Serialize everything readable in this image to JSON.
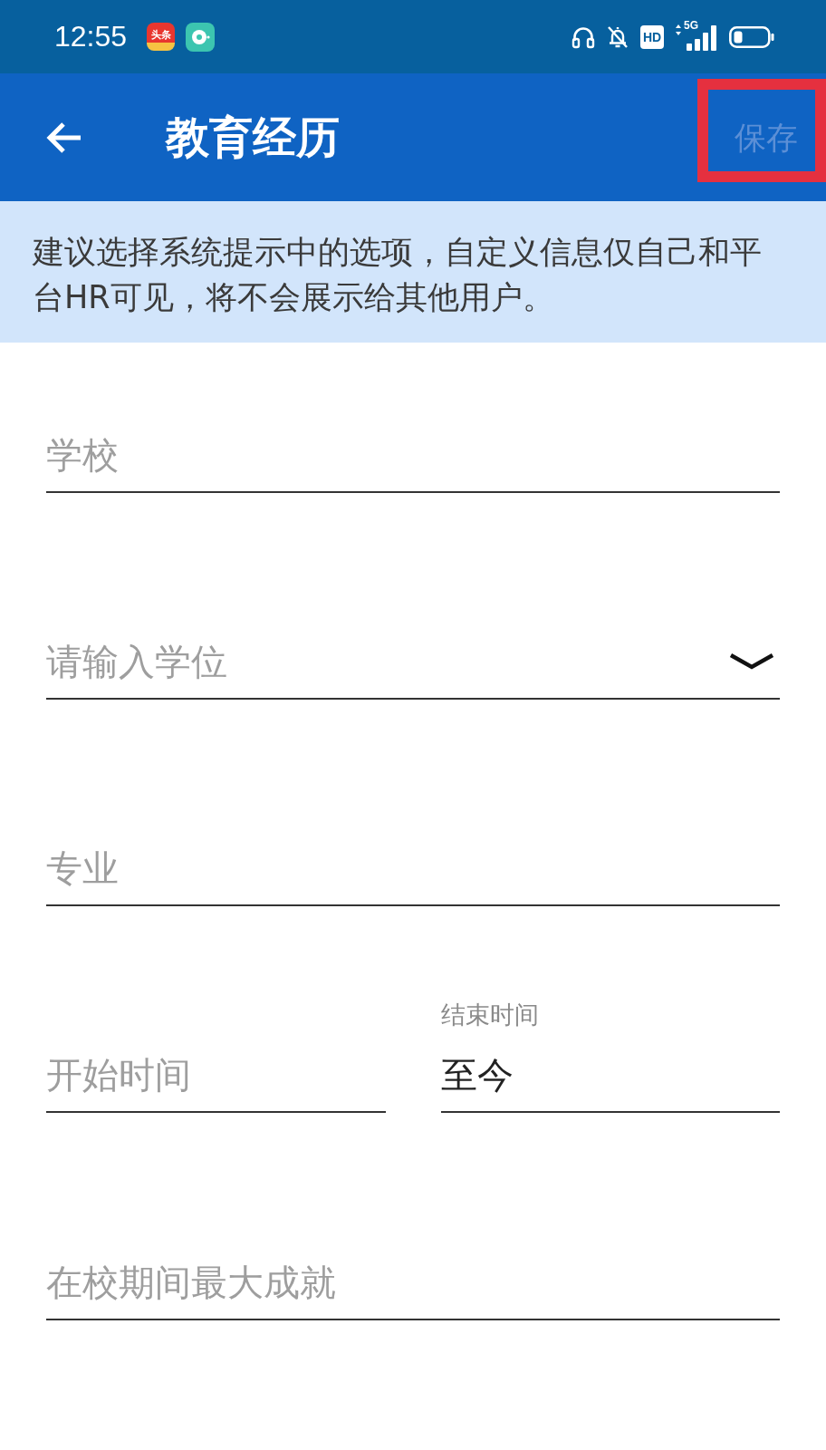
{
  "status_bar": {
    "time": "12:55",
    "app_icons": [
      {
        "kind": "news",
        "label": "头条"
      },
      {
        "kind": "music"
      }
    ],
    "hd_label": "HD",
    "network_label": "5G"
  },
  "header": {
    "title": "教育经历",
    "save_button": {
      "label": "保存",
      "disabled": true,
      "highlighted": true
    }
  },
  "notice": "建议选择系统提示中的选项，自定义信息仅自己和平台HR可见，将不会展示给其他用户。",
  "fields": [
    {
      "kind": "text",
      "placeholder": "学校"
    },
    {
      "kind": "select",
      "placeholder": "请输入学位"
    },
    {
      "kind": "text",
      "placeholder": "专业"
    },
    {
      "kind": "date_pair",
      "items": [
        {
          "placeholder": "开始时间"
        },
        {
          "label": "结束时间",
          "value": "至今"
        }
      ]
    },
    {
      "kind": "text",
      "placeholder": "在校期间最大成就"
    }
  ]
}
